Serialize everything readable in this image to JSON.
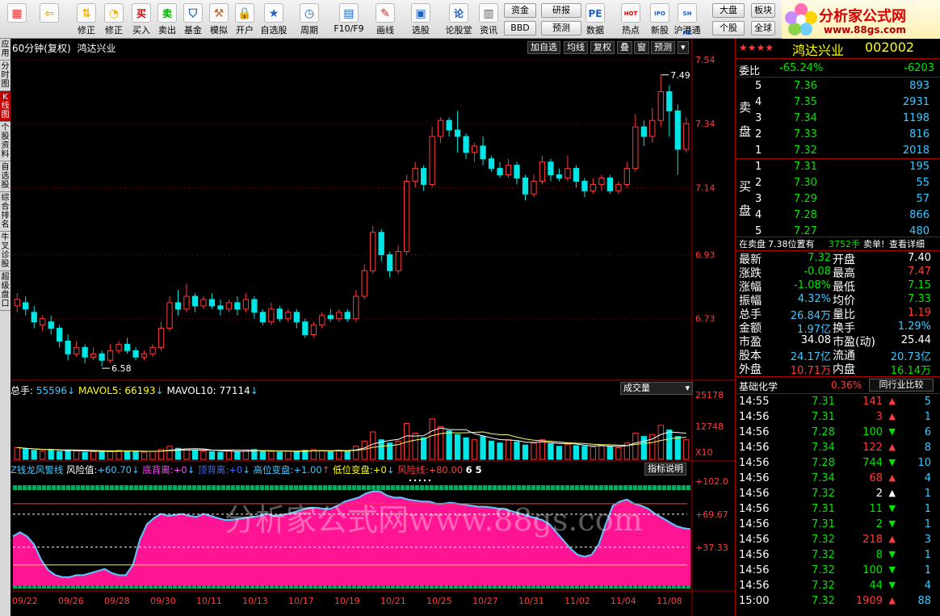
{
  "toolbar": {
    "items": [
      {
        "label": "",
        "icon": "grid-icon"
      },
      {
        "label": "",
        "icon": "back-arrow-icon"
      },
      {
        "label": "修正",
        "icon": "updown-arrows-icon"
      },
      {
        "label": "修正",
        "icon": "clock-icon"
      },
      {
        "label": "买入",
        "icon": "buy-icon",
        "glyph": "买"
      },
      {
        "label": "卖出",
        "icon": "sell-icon",
        "glyph": "卖"
      },
      {
        "label": "基金",
        "icon": "shield-icon"
      },
      {
        "label": "模拟",
        "icon": "hammer-icon"
      },
      {
        "label": "开户",
        "icon": "lock-icon"
      },
      {
        "label": "自选股",
        "icon": "star-icon"
      },
      {
        "label": "周期",
        "icon": "clock-icon"
      },
      {
        "label": "F10/F9",
        "icon": "document-icon"
      },
      {
        "label": "画线",
        "icon": "pencil-icon"
      },
      {
        "label": "选股",
        "icon": "monitor-icon"
      },
      {
        "label": "论股堂",
        "icon": "discuss-icon",
        "glyph": "论"
      },
      {
        "label": "资讯",
        "icon": "news-icon"
      },
      {
        "label": "数据",
        "icon": "pe-icon",
        "glyph": "PE"
      },
      {
        "label": "热点",
        "icon": "hot-icon",
        "glyph": "HOT"
      },
      {
        "label": "新股",
        "icon": "ipo-icon",
        "glyph": "IPO"
      },
      {
        "label": "沪港通",
        "icon": "shhk-icon",
        "glyph": "SH HK"
      }
    ],
    "small_buttons": [
      "资金",
      "研报",
      "BBD",
      "预测",
      "大盘",
      "板块",
      "个股",
      "全球"
    ]
  },
  "logo": {
    "title": "分析家公式网",
    "url_text": "www.88gs.com"
  },
  "left_tabs": [
    {
      "label": "应用",
      "active": false
    },
    {
      "label": "分时图",
      "active": false
    },
    {
      "label": "K线图",
      "active": true
    },
    {
      "label": "个股资料",
      "active": false
    },
    {
      "label": "自选股",
      "active": false
    },
    {
      "label": "综合排名",
      "active": false
    },
    {
      "label": "牛叉诊股",
      "active": false
    },
    {
      "label": "超级盘口",
      "active": false
    }
  ],
  "chart_header": {
    "period": "60分钟(复权)",
    "stock_name": "鸿达兴业",
    "buttons": [
      "加自选",
      "均线",
      "复权",
      "叠",
      "窗",
      "预测"
    ]
  },
  "volume_header": {
    "total_label": "总手:",
    "total_value": "55596",
    "mavol5_label": "MAVOL5:",
    "mavol5_value": "66193",
    "mavol10_label": "MAVOL10:",
    "mavol10_value": "77114",
    "dropdown": "成交量"
  },
  "indicator_header": {
    "name": "Z钱龙风警线",
    "risk_label": "风险值:",
    "risk_value": "+60.70",
    "bottom_div_label": "底背离:",
    "bottom_div_value": "+0",
    "top_div_label": "顶背离:",
    "top_div_value": "+0",
    "high_label": "高位变盘:",
    "high_value": "+1.00",
    "low_label": "低位变盘:",
    "low_value": "+0",
    "line_label": "风险线:",
    "line_value": "+80.00",
    "extra": "6 5",
    "help_button": "指标说明"
  },
  "watermark": "分析家公式网www.88gs.com",
  "price_axis": [
    "7.54",
    "7.34",
    "7.14",
    "6.93",
    "6.73"
  ],
  "volume_axis": [
    "25178",
    "12748",
    "X10"
  ],
  "indicator_axis": [
    "+102.0",
    "+69.67",
    "+37.33"
  ],
  "date_axis": [
    "09/22",
    "09/26",
    "09/28",
    "09/30",
    "10/11",
    "10/13",
    "10/17",
    "10/19",
    "10/21",
    "10/25",
    "10/27",
    "10/31",
    "11/02",
    "11/04",
    "11/08"
  ],
  "chart_data": {
    "type": "candlestick",
    "price_range": [
      6.55,
      7.55
    ],
    "annotations": [
      {
        "label": "7.49"
      },
      {
        "label": "6.58"
      }
    ],
    "candles": [
      [
        6.77,
        6.79,
        6.81,
        6.75
      ],
      [
        6.78,
        6.76,
        6.8,
        6.74
      ],
      [
        6.75,
        6.72,
        6.77,
        6.7
      ],
      [
        6.71,
        6.73,
        6.74,
        6.69
      ],
      [
        6.72,
        6.7,
        6.74,
        6.68
      ],
      [
        6.7,
        6.66,
        6.71,
        6.64
      ],
      [
        6.66,
        6.62,
        6.68,
        6.6
      ],
      [
        6.62,
        6.64,
        6.66,
        6.61
      ],
      [
        6.64,
        6.61,
        6.65,
        6.59
      ],
      [
        6.61,
        6.62,
        6.64,
        6.6
      ],
      [
        6.62,
        6.6,
        6.63,
        6.58
      ],
      [
        6.6,
        6.63,
        6.65,
        6.59
      ],
      [
        6.63,
        6.65,
        6.66,
        6.62
      ],
      [
        6.65,
        6.63,
        6.67,
        6.62
      ],
      [
        6.63,
        6.61,
        6.64,
        6.6
      ],
      [
        6.61,
        6.62,
        6.63,
        6.6
      ],
      [
        6.62,
        6.64,
        6.65,
        6.61
      ],
      [
        6.64,
        6.7,
        6.72,
        6.63
      ],
      [
        6.7,
        6.78,
        6.8,
        6.69
      ],
      [
        6.78,
        6.76,
        6.82,
        6.74
      ],
      [
        6.76,
        6.8,
        6.84,
        6.75
      ],
      [
        6.8,
        6.77,
        6.81,
        6.75
      ],
      [
        6.77,
        6.79,
        6.8,
        6.76
      ],
      [
        6.79,
        6.77,
        6.81,
        6.76
      ],
      [
        6.77,
        6.76,
        6.79,
        6.74
      ],
      [
        6.76,
        6.78,
        6.79,
        6.75
      ],
      [
        6.78,
        6.76,
        6.8,
        6.74
      ],
      [
        6.76,
        6.79,
        6.81,
        6.75
      ],
      [
        6.79,
        6.75,
        6.8,
        6.73
      ],
      [
        6.75,
        6.72,
        6.76,
        6.71
      ],
      [
        6.72,
        6.76,
        6.78,
        6.71
      ],
      [
        6.76,
        6.73,
        6.77,
        6.72
      ],
      [
        6.73,
        6.75,
        6.76,
        6.72
      ],
      [
        6.75,
        6.72,
        6.76,
        6.7
      ],
      [
        6.72,
        6.68,
        6.73,
        6.67
      ],
      [
        6.68,
        6.71,
        6.72,
        6.67
      ],
      [
        6.71,
        6.74,
        6.75,
        6.7
      ],
      [
        6.74,
        6.73,
        6.76,
        6.72
      ],
      [
        6.73,
        6.75,
        6.76,
        6.72
      ],
      [
        6.75,
        6.73,
        6.76,
        6.72
      ],
      [
        6.73,
        6.8,
        6.82,
        6.72
      ],
      [
        6.8,
        6.88,
        6.9,
        6.79
      ],
      [
        6.88,
        7.0,
        7.02,
        6.87
      ],
      [
        7.0,
        6.93,
        7.01,
        6.91
      ],
      [
        6.93,
        6.88,
        6.94,
        6.86
      ],
      [
        6.88,
        6.94,
        6.96,
        6.87
      ],
      [
        6.94,
        7.16,
        7.18,
        6.93
      ],
      [
        7.16,
        7.2,
        7.22,
        7.14
      ],
      [
        7.2,
        7.15,
        7.21,
        7.13
      ],
      [
        7.15,
        7.3,
        7.33,
        7.14
      ],
      [
        7.3,
        7.35,
        7.36,
        7.28
      ],
      [
        7.35,
        7.32,
        7.36,
        7.3
      ],
      [
        7.32,
        7.3,
        7.38,
        7.25
      ],
      [
        7.3,
        7.25,
        7.31,
        7.23
      ],
      [
        7.25,
        7.27,
        7.28,
        7.22
      ],
      [
        7.27,
        7.23,
        7.3,
        7.21
      ],
      [
        7.23,
        7.2,
        7.24,
        7.19
      ],
      [
        7.2,
        7.18,
        7.22,
        7.17
      ],
      [
        7.18,
        7.21,
        7.23,
        7.17
      ],
      [
        7.21,
        7.17,
        7.22,
        7.15
      ],
      [
        7.17,
        7.12,
        7.18,
        7.1
      ],
      [
        7.12,
        7.16,
        7.18,
        7.11
      ],
      [
        7.16,
        7.22,
        7.24,
        7.15
      ],
      [
        7.22,
        7.18,
        7.23,
        7.16
      ],
      [
        7.18,
        7.17,
        7.2,
        7.16
      ],
      [
        7.17,
        7.2,
        7.24,
        7.16
      ],
      [
        7.2,
        7.16,
        7.21,
        7.14
      ],
      [
        7.16,
        7.13,
        7.17,
        7.11
      ],
      [
        7.13,
        7.15,
        7.17,
        7.12
      ],
      [
        7.15,
        7.17,
        7.18,
        7.13
      ],
      [
        7.17,
        7.13,
        7.18,
        7.12
      ],
      [
        7.13,
        7.15,
        7.16,
        7.12
      ],
      [
        7.15,
        7.2,
        7.22,
        7.14
      ],
      [
        7.2,
        7.33,
        7.37,
        7.19
      ],
      [
        7.33,
        7.3,
        7.35,
        7.27
      ],
      [
        7.3,
        7.35,
        7.39,
        7.28
      ],
      [
        7.35,
        7.44,
        7.49,
        7.33
      ],
      [
        7.44,
        7.38,
        7.46,
        7.3
      ],
      [
        7.38,
        7.26,
        7.4,
        7.18
      ],
      [
        7.26,
        7.34,
        7.36,
        7.25
      ]
    ],
    "volume": [
      0.18,
      0.16,
      0.14,
      0.13,
      0.15,
      0.12,
      0.14,
      0.13,
      0.11,
      0.12,
      0.13,
      0.12,
      0.14,
      0.13,
      0.12,
      0.11,
      0.12,
      0.15,
      0.2,
      0.17,
      0.16,
      0.14,
      0.13,
      0.12,
      0.11,
      0.13,
      0.12,
      0.14,
      0.15,
      0.13,
      0.12,
      0.11,
      0.13,
      0.12,
      0.14,
      0.15,
      0.13,
      0.12,
      0.14,
      0.13,
      0.2,
      0.28,
      0.42,
      0.3,
      0.25,
      0.28,
      0.55,
      0.4,
      0.33,
      0.62,
      0.5,
      0.44,
      0.38,
      0.33,
      0.3,
      0.35,
      0.28,
      0.25,
      0.3,
      0.27,
      0.22,
      0.25,
      0.3,
      0.24,
      0.2,
      0.23,
      0.21,
      0.2,
      0.19,
      0.22,
      0.2,
      0.18,
      0.25,
      0.4,
      0.35,
      0.38,
      0.52,
      0.45,
      0.35,
      0.3
    ],
    "volume_x10": true,
    "indicator": [
      48,
      52,
      48,
      40,
      25,
      15,
      10,
      8,
      8,
      10,
      10,
      12,
      14,
      16,
      12,
      10,
      10,
      20,
      45,
      60,
      66,
      70,
      68,
      69,
      70,
      68,
      67,
      70,
      68,
      66,
      64,
      64,
      65,
      66,
      67,
      68,
      70,
      68,
      69,
      70,
      72,
      74,
      76,
      76,
      75,
      75,
      78,
      82,
      84,
      86,
      90,
      92,
      92,
      88,
      86,
      86,
      84,
      83,
      82,
      82,
      80,
      80,
      81,
      80,
      79,
      78,
      77,
      77,
      76,
      75,
      74,
      72,
      70,
      68,
      66,
      64,
      60,
      52,
      44,
      36,
      30,
      28,
      30,
      40,
      60,
      78,
      82,
      84,
      80,
      78,
      75,
      70,
      66,
      62,
      58,
      56,
      55
    ]
  },
  "quote": {
    "stars": "★★★★",
    "name": "鸿达兴业",
    "code": "002002",
    "weibi_label": "委比",
    "weibi_value": "-65.24%",
    "weibi_diff": "-6203",
    "sell_label": "卖盘",
    "buy_label": "买盘",
    "asks": [
      {
        "level": "5",
        "price": "7.36",
        "vol": "893"
      },
      {
        "level": "4",
        "price": "7.35",
        "vol": "2931"
      },
      {
        "level": "3",
        "price": "7.34",
        "vol": "1198"
      },
      {
        "level": "2",
        "price": "7.33",
        "vol": "816"
      },
      {
        "level": "1",
        "price": "7.32",
        "vol": "2018"
      }
    ],
    "bids": [
      {
        "level": "1",
        "price": "7.31",
        "vol": "195"
      },
      {
        "level": "2",
        "price": "7.30",
        "vol": "55"
      },
      {
        "level": "3",
        "price": "7.29",
        "vol": "57"
      },
      {
        "level": "4",
        "price": "7.28",
        "vol": "866"
      },
      {
        "level": "5",
        "price": "7.27",
        "vol": "480"
      }
    ],
    "notice_pre": "在卖盘",
    "notice_price": "7.38位置有",
    "notice_vol": "3752手",
    "notice_post": "卖单!",
    "notice_link": "查看详细",
    "stats": [
      {
        "l1": "最新",
        "v1": "7.32",
        "c1": "dn",
        "l2": "开盘",
        "v2": "7.40",
        "c2": "wh"
      },
      {
        "l1": "涨跌",
        "v1": "-0.08",
        "c1": "dn",
        "l2": "最高",
        "v2": "7.47",
        "c2": "up"
      },
      {
        "l1": "涨幅",
        "v1": "-1.08%",
        "c1": "dn",
        "l2": "最低",
        "v2": "7.15",
        "c2": "dn"
      },
      {
        "l1": "振幅",
        "v1": "4.32%",
        "c1": "cy",
        "l2": "均价",
        "v2": "7.33",
        "c2": "dn"
      },
      {
        "l1": "总手",
        "v1": "26.84万",
        "c1": "cy",
        "l2": "量比",
        "v2": "1.19",
        "c2": "up"
      },
      {
        "l1": "金额",
        "v1": "1.97亿",
        "c1": "cy",
        "l2": "换手",
        "v2": "1.29%",
        "c2": "cy"
      },
      {
        "l1": "市盈",
        "v1": "34.08",
        "c1": "wh",
        "l2": "市盈(动)",
        "v2": "25.44",
        "c2": "wh"
      },
      {
        "l1": "股本",
        "v1": "24.17亿",
        "c1": "cy",
        "l2": "流通",
        "v2": "20.73亿",
        "c2": "cy"
      },
      {
        "l1": "外盘",
        "v1": "10.71万",
        "c1": "up",
        "l2": "内盘",
        "v2": "16.14万",
        "c2": "dn"
      }
    ],
    "industry_name": "基础化学",
    "industry_pct": "0.36%",
    "industry_button": "同行业比较",
    "ticks": [
      {
        "t": "14:55",
        "p": "7.31",
        "v": "141",
        "d": "up",
        "n": "5"
      },
      {
        "t": "14:56",
        "p": "7.31",
        "v": "3",
        "d": "up",
        "n": "1"
      },
      {
        "t": "14:56",
        "p": "7.28",
        "v": "100",
        "d": "dn",
        "n": "6"
      },
      {
        "t": "14:56",
        "p": "7.34",
        "v": "122",
        "d": "up",
        "n": "8"
      },
      {
        "t": "14:56",
        "p": "7.28",
        "v": "744",
        "d": "dn",
        "n": "10"
      },
      {
        "t": "14:56",
        "p": "7.34",
        "v": "68",
        "d": "up",
        "n": "4"
      },
      {
        "t": "14:56",
        "p": "7.32",
        "v": "2",
        "d": "wh",
        "n": "1"
      },
      {
        "t": "14:56",
        "p": "7.31",
        "v": "11",
        "d": "dn",
        "n": "1"
      },
      {
        "t": "14:56",
        "p": "7.31",
        "v": "2",
        "d": "dn",
        "n": "1"
      },
      {
        "t": "14:56",
        "p": "7.32",
        "v": "218",
        "d": "up",
        "n": "3"
      },
      {
        "t": "14:56",
        "p": "7.32",
        "v": "8",
        "d": "dn",
        "n": "1"
      },
      {
        "t": "14:56",
        "p": "7.32",
        "v": "100",
        "d": "dn",
        "n": "1"
      },
      {
        "t": "14:56",
        "p": "7.32",
        "v": "44",
        "d": "dn",
        "n": "4"
      },
      {
        "t": "15:00",
        "p": "7.32",
        "v": "1909",
        "d": "up",
        "n": "88"
      }
    ]
  },
  "colors": {
    "up": "#ff3b3b",
    "down": "#00e6e6",
    "indicator_fill": "#ff1493",
    "indicator_line": "#5fc8ff",
    "accent": "#c00000"
  }
}
